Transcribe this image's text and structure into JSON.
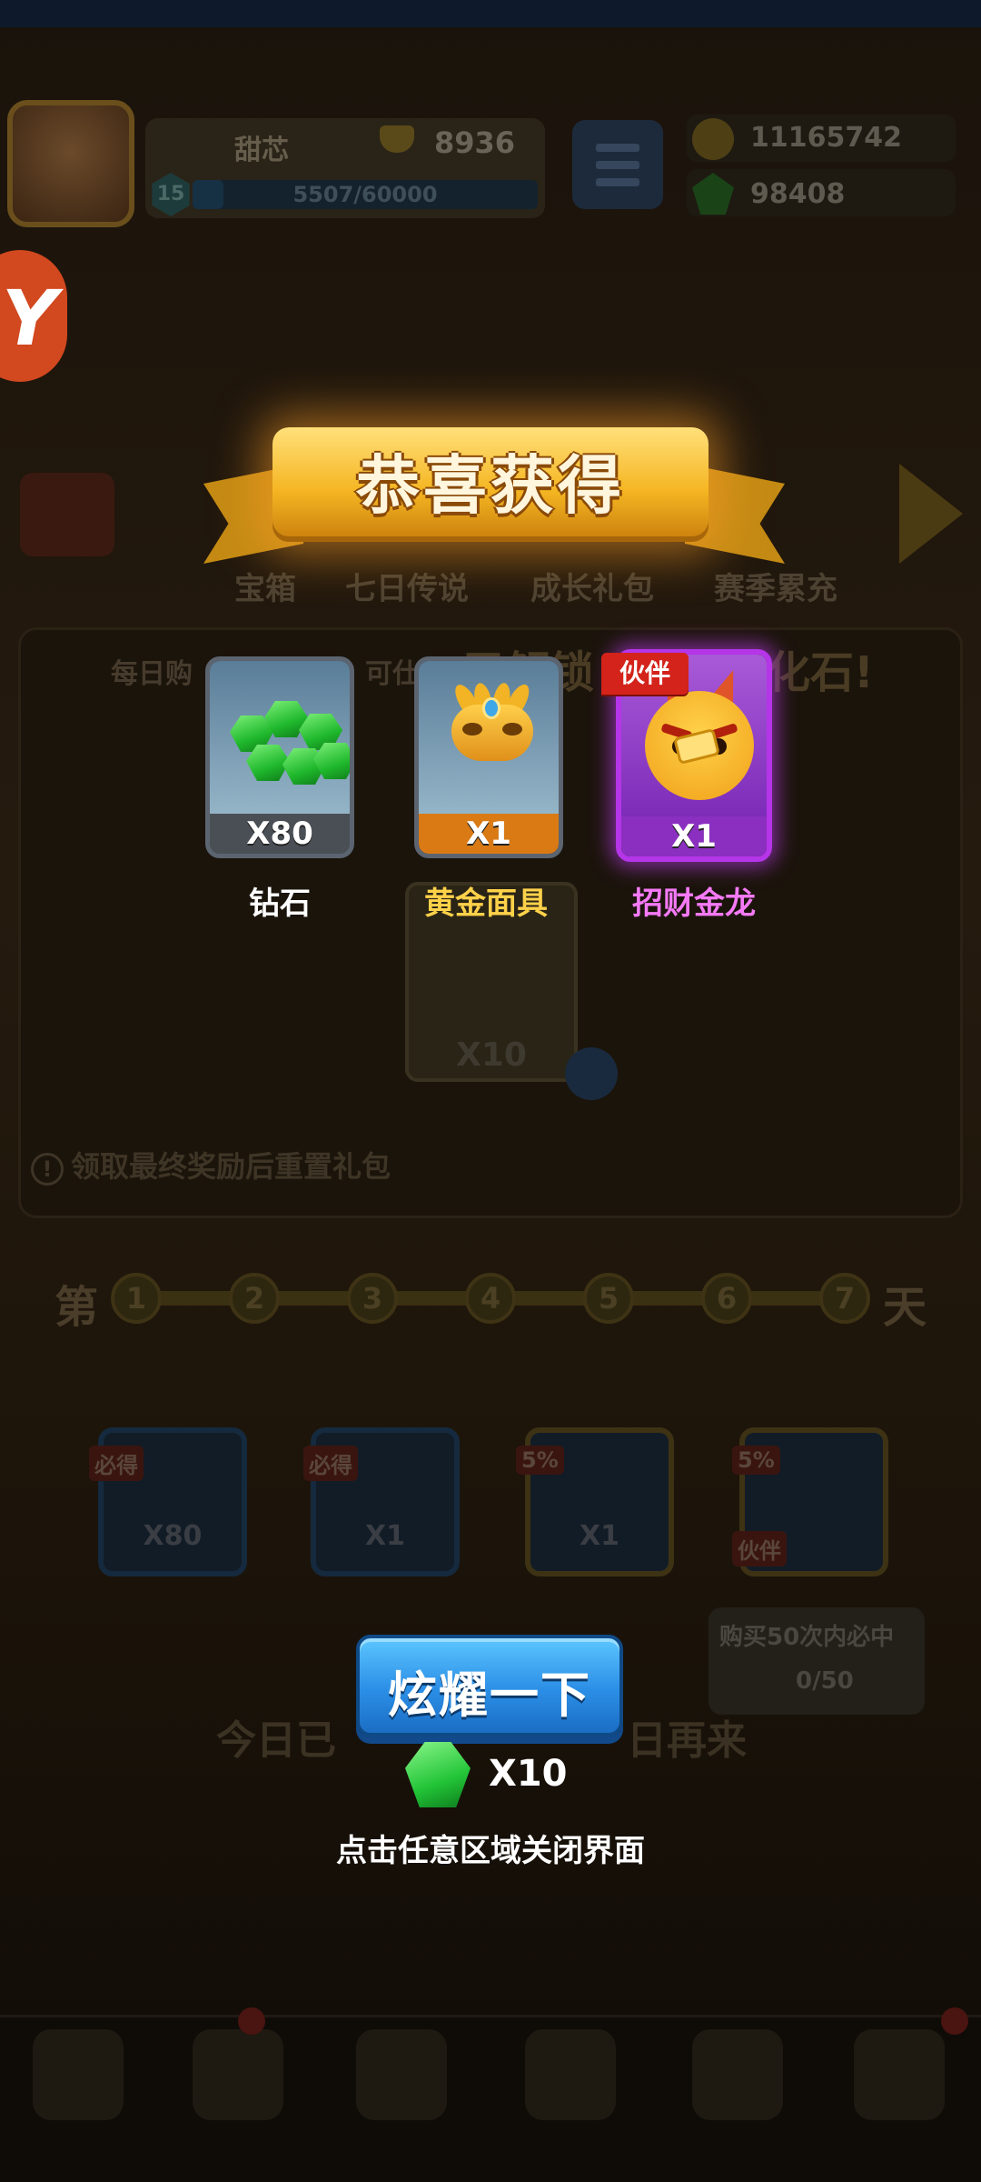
{
  "player": {
    "name": "甜芯",
    "trophies": "8936",
    "level": "15",
    "xp_text": "5507/60000",
    "xp_progress": 0.09
  },
  "resources": {
    "gold": "11165742",
    "gems": "98408"
  },
  "background": {
    "tabs": [
      "宝箱",
      "七日传说",
      "成长礼包",
      "赛季累充"
    ],
    "daily_text": "每日购",
    "can_text": "可仕",
    "unlock_text": "已解锁",
    "unlock_suffix": "化石!",
    "bg_card_qty": "X10",
    "info_text": "领取最终奖励后重置礼包",
    "day_prefix": "第",
    "day_suffix": "天",
    "days": [
      "1",
      "2",
      "3",
      "4",
      "5",
      "6",
      "7"
    ],
    "rewards": [
      {
        "tag": "必得",
        "qty": "X80"
      },
      {
        "tag": "必得",
        "qty": "X1"
      },
      {
        "tag": "5%",
        "qty": "X1"
      },
      {
        "tag": "5%",
        "qty": "",
        "sub_tag": "伙伴"
      }
    ],
    "bubble_title": "购买50次内必中",
    "bubble_count": "0/50",
    "today_left": "今日已",
    "today_right": "日再来"
  },
  "popup": {
    "title": "恭喜获得",
    "items": [
      {
        "name": "钻石",
        "qty": "X80",
        "icon": "gem-pile-icon"
      },
      {
        "name": "黄金面具",
        "qty": "X1",
        "icon": "golden-mask-icon"
      },
      {
        "name": "招财金龙",
        "qty": "X1",
        "icon": "fortune-dragon-icon",
        "tag": "伙伴"
      }
    ],
    "share_button": "炫耀一下",
    "share_cost": "X10",
    "close_hint": "点击任意区域关闭界面"
  },
  "colors": {
    "banner_gold": "#f5b623",
    "share_blue": "#2b8ee6",
    "mask_orange": "#d97a14",
    "partner_purple": "#b535e8",
    "partner_tag_red": "#d3231a",
    "name_gold": "#ffd24a",
    "name_pink": "#f47af6"
  }
}
